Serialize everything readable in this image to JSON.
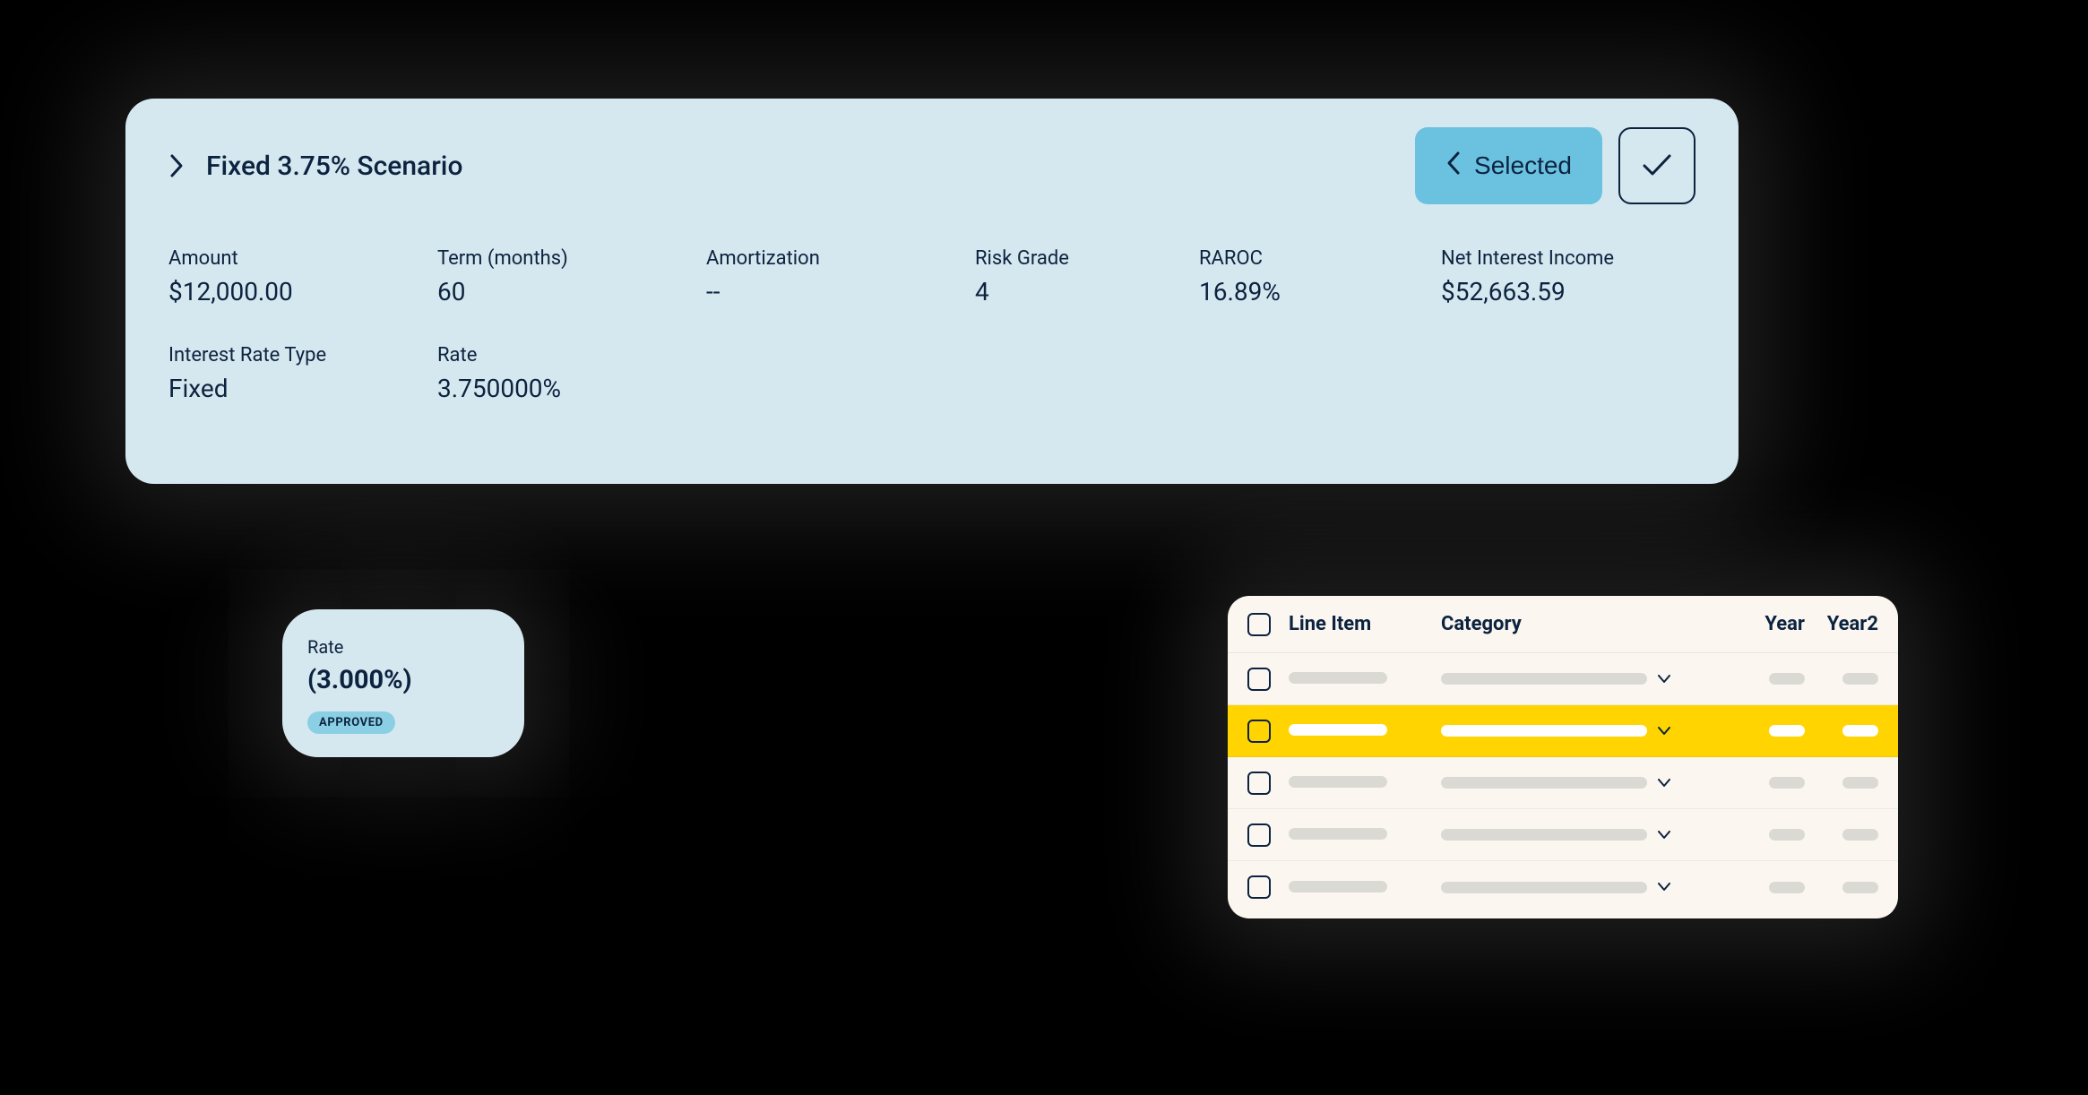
{
  "scenario": {
    "title": "Fixed 3.75% Scenario",
    "selected_label": "Selected",
    "metrics": {
      "amount": {
        "label": "Amount",
        "value": "$12,000.00"
      },
      "term": {
        "label": "Term (months)",
        "value": "60"
      },
      "amort": {
        "label": "Amortization",
        "value": "--"
      },
      "risk": {
        "label": "Risk Grade",
        "value": "4"
      },
      "raroc": {
        "label": "RAROC",
        "value": "16.89%"
      },
      "nii": {
        "label": "Net Interest Income",
        "value": "$52,663.59"
      },
      "irtype": {
        "label": "Interest Rate Type",
        "value": "Fixed"
      },
      "rate": {
        "label": "Rate",
        "value": "3.750000%"
      }
    }
  },
  "rate_card": {
    "label": "Rate",
    "value": "(3.000%)",
    "status": "APPROVED"
  },
  "table": {
    "headers": {
      "line_item": "Line Item",
      "category": "Category",
      "year": "Year",
      "year2": "Year2"
    }
  }
}
